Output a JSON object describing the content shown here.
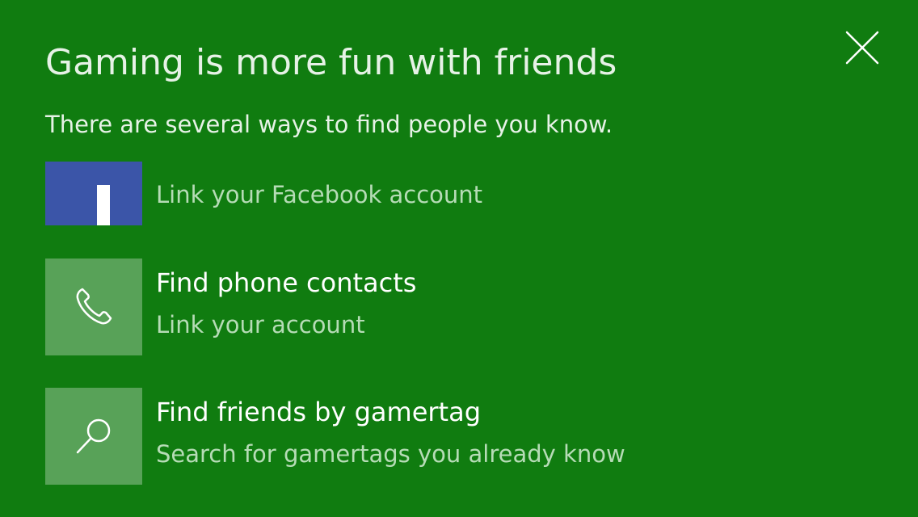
{
  "dialog": {
    "title": "Gaming is more fun with friends",
    "subtitle": "There are several ways to find people you know.",
    "close_icon": "close-icon"
  },
  "options": [
    {
      "icon": "facebook-icon",
      "title": "",
      "subtitle": "Link your Facebook account",
      "tile_color": "#3b55a8"
    },
    {
      "icon": "phone-icon",
      "title": "Find phone contacts",
      "subtitle": "Link your account",
      "tile_color": "#58a258"
    },
    {
      "icon": "search-icon",
      "title": "Find friends by gamertag",
      "subtitle": "Search for gamertags you already know",
      "tile_color": "#58a258"
    }
  ],
  "colors": {
    "background": "#107c10",
    "tile": "#58a258",
    "facebook": "#3b55a8",
    "secondary_text": "#b6dcb6"
  }
}
